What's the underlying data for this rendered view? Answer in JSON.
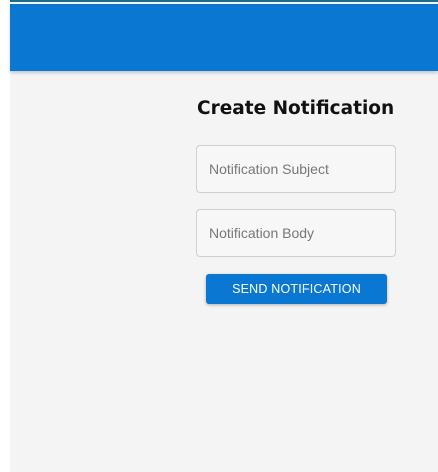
{
  "colors": {
    "appbar": "#0a78d2",
    "background": "#f4f4f4",
    "button": "#0a78d2",
    "topline": "#1a6e86"
  },
  "form": {
    "title": "Create Notification",
    "subject_placeholder": "Notification Subject",
    "subject_value": "",
    "body_placeholder": "Notification Body",
    "body_value": "",
    "send_label": "SEND NOTIFICATION"
  }
}
